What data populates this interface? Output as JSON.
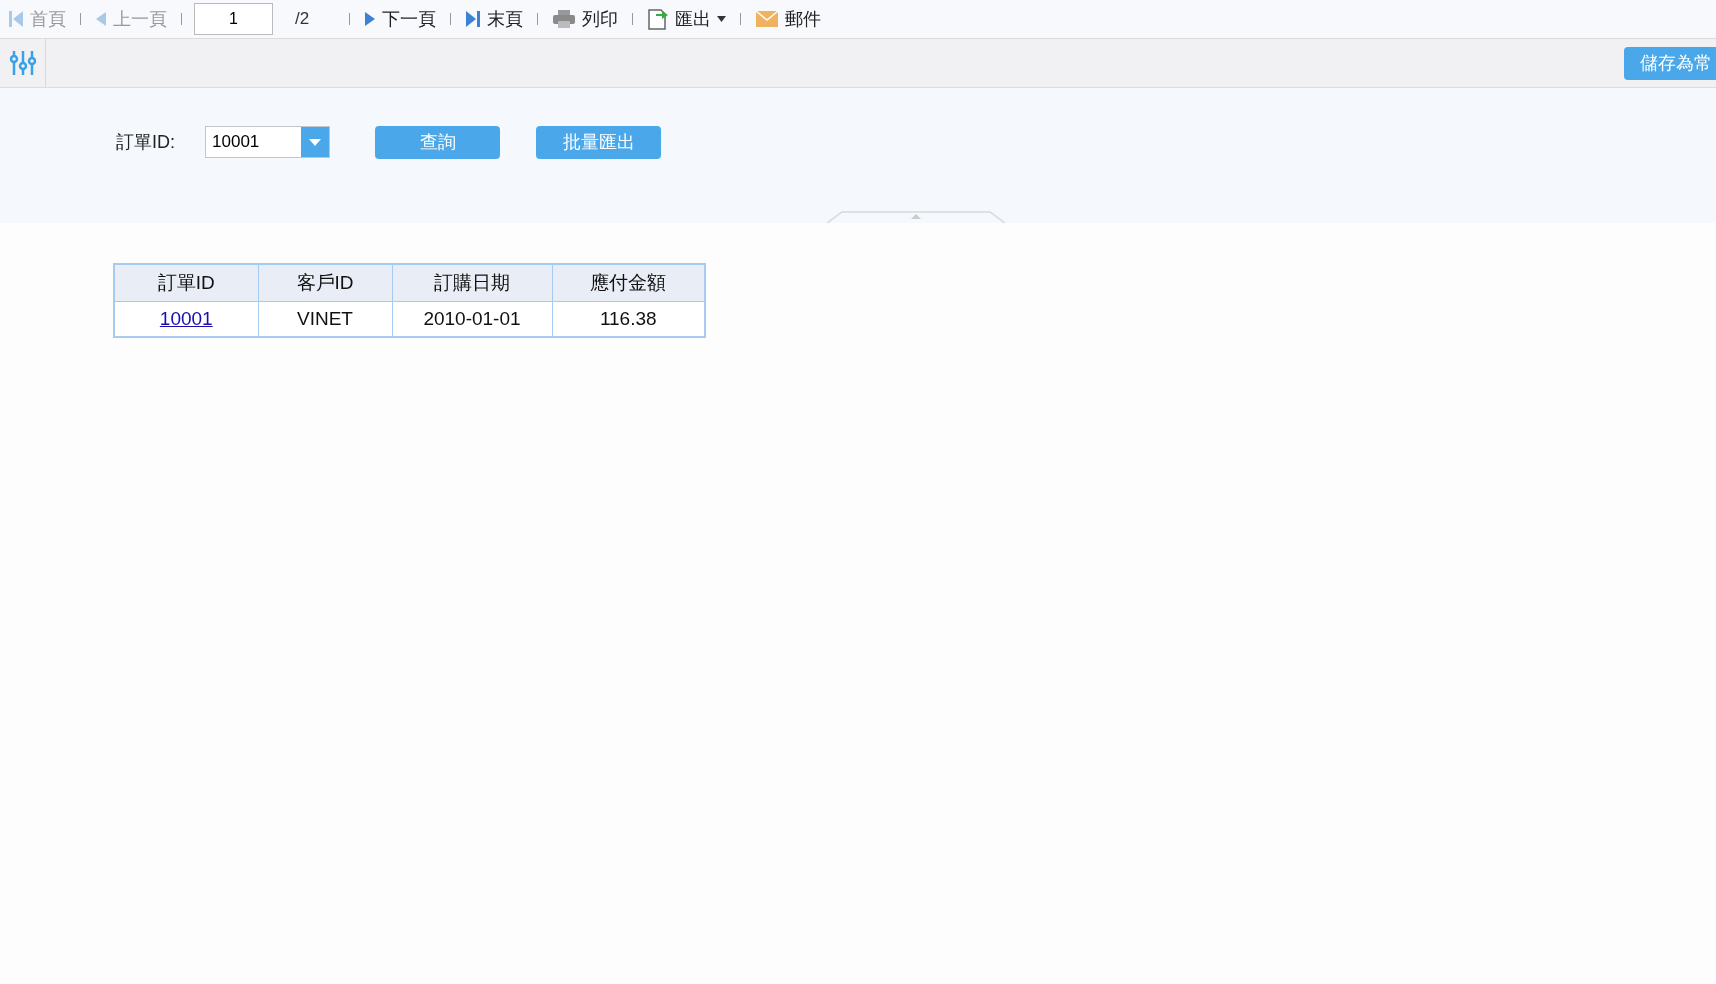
{
  "toolbar": {
    "items": [
      {
        "kind": "first",
        "label": "首頁",
        "disabled": true
      },
      {
        "kind": "prev",
        "label": "上一頁",
        "disabled": true
      },
      {
        "kind": "page",
        "value": "1",
        "total": "/2"
      },
      {
        "kind": "next",
        "label": "下一頁",
        "disabled": false
      },
      {
        "kind": "last",
        "label": "末頁",
        "disabled": false
      },
      {
        "kind": "print",
        "label": "列印",
        "disabled": false
      },
      {
        "kind": "export",
        "label": "匯出",
        "disabled": false
      },
      {
        "kind": "mail",
        "label": "郵件",
        "disabled": false
      }
    ]
  },
  "param_bar": {
    "save_button": "儲存為常"
  },
  "form": {
    "label": "訂單ID:",
    "select_value": "10001",
    "buttons": [
      "查詢",
      "批量匯出"
    ]
  },
  "table": {
    "columns": [
      "訂單ID",
      "客戶ID",
      "訂購日期",
      "應付金額"
    ],
    "rows": [
      [
        {
          "text": "10001",
          "link": true
        },
        {
          "text": "VINET",
          "link": false
        },
        {
          "text": "2010-01-01",
          "link": false
        },
        {
          "text": "116.38",
          "link": false
        }
      ]
    ]
  }
}
